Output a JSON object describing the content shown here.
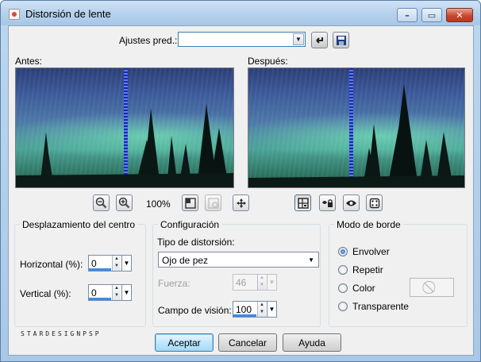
{
  "window": {
    "title": "Distorsión de lente",
    "minimize_glyph": "–",
    "maximize_glyph": "▭",
    "close_glyph": "✕"
  },
  "presets": {
    "label": "Ajustes pred.:",
    "value": "",
    "icons": [
      "reset-icon",
      "save-icon"
    ]
  },
  "preview": {
    "before_label": "Antes:",
    "after_label": "Después:",
    "zoom_level": "100%",
    "toolbar_icons": [
      "zoom-out-icon",
      "zoom-in-icon",
      "fit-to-window-icon",
      "navigate-icon",
      "move-icon"
    ],
    "view_icons": [
      "split-view-icon",
      "lock-icon",
      "eye-icon",
      "randomize-icon"
    ]
  },
  "center_offset": {
    "title": "Desplazamiento del centro",
    "horizontal_label": "Horizontal (%):",
    "horizontal_value": "0",
    "vertical_label": "Vertical (%):",
    "vertical_value": "0"
  },
  "settings": {
    "title": "Configuración",
    "distortion_type_label": "Tipo de distorsión:",
    "distortion_type_value": "Ojo de pez",
    "strength_label": "Fuerza:",
    "strength_value": "46",
    "field_of_view_label": "Campo de visión:",
    "field_of_view_value": "100"
  },
  "edge_mode": {
    "title": "Modo de borde",
    "options": [
      {
        "label": "Envolver",
        "checked": true
      },
      {
        "label": "Repetir",
        "checked": false
      },
      {
        "label": "Color",
        "checked": false
      },
      {
        "label": "Transparente",
        "checked": false
      }
    ]
  },
  "watermark": "STARDESIGNPSP",
  "buttons": {
    "ok": "Aceptar",
    "cancel": "Cancelar",
    "help": "Ayuda"
  },
  "colors": {
    "accent": "#3d8ae8",
    "title_bar": "#b7d2ec",
    "close_button": "#c9472f"
  }
}
